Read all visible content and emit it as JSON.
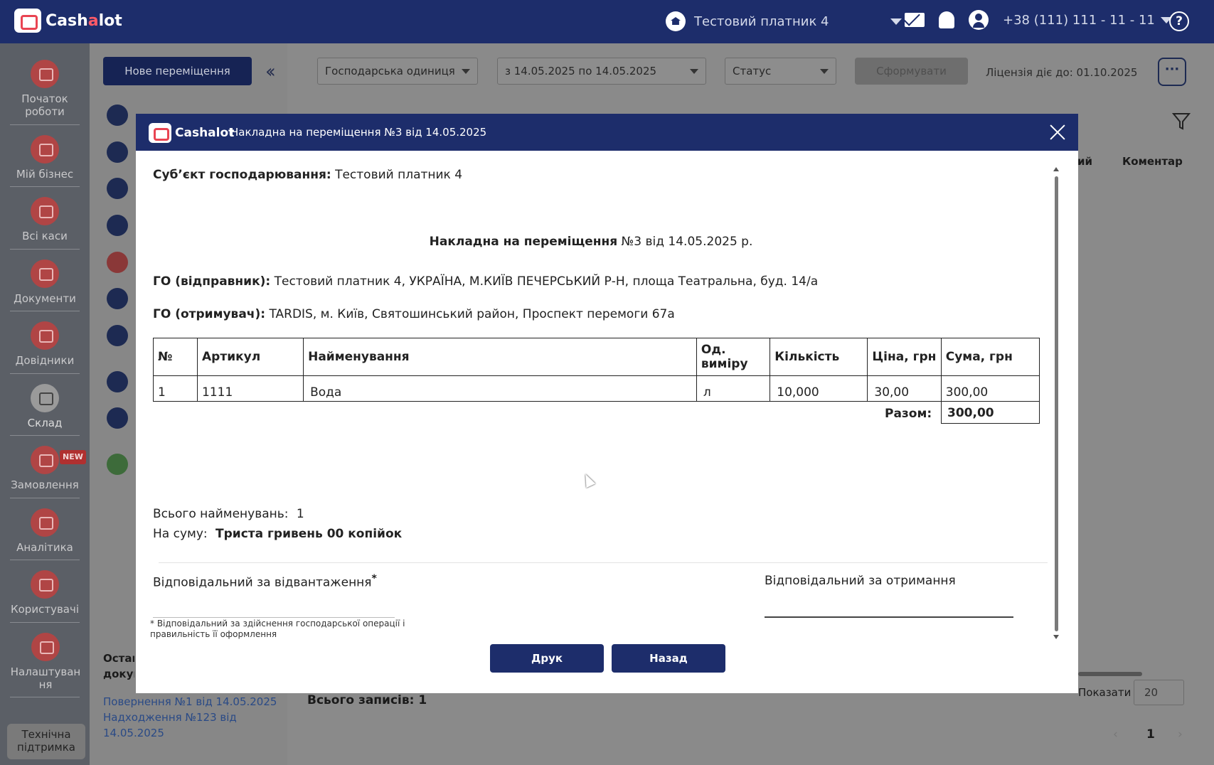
{
  "topbar": {
    "logo_text_pre": "Cash",
    "logo_text_accent": "a",
    "logo_text_post": "lot",
    "org_name": "Тестовий платник 4",
    "phone": "+38 (111) 111 - 11 - 11",
    "help": "?"
  },
  "sidebar": {
    "items": [
      {
        "label": "Початок роботи",
        "icon": "rocket-icon"
      },
      {
        "label": "Мій бізнес",
        "icon": "home-icon"
      },
      {
        "label": "Всі каси",
        "icon": "cash-register-icon"
      },
      {
        "label": "Документи",
        "icon": "documents-icon"
      },
      {
        "label": "Довідники",
        "icon": "directory-icon"
      },
      {
        "label": "Склад",
        "icon": "warehouse-icon"
      },
      {
        "label": "Замовлення",
        "icon": "delivery-icon"
      },
      {
        "label": "Аналітика",
        "icon": "analytics-icon"
      },
      {
        "label": "Користувачі",
        "icon": "users-icon"
      },
      {
        "label": "Налаштування",
        "icon": "gear-icon"
      }
    ],
    "new_badge": "NEW",
    "support_button": "Технічна підтримка"
  },
  "subpanel": {
    "new_move_button": "Нове переміщення",
    "last_docs_title": "Останні документи",
    "last_links": [
      "Повернення №1 від 14.05.2025",
      "Надходження №123 від 14.05.2025"
    ]
  },
  "filters": {
    "unit_placeholder": "Господарська одиниця",
    "date_range": "з 14.05.2025 по 14.05.2025",
    "status_placeholder": "Статус",
    "form_button": "Сформувати",
    "license": "Ліцензія діє до: 01.10.2025",
    "more": "···"
  },
  "table_bg": {
    "col_partial": "ий",
    "col_comment": "Коментар",
    "total_records": "Всього записів: 1",
    "show_label": "Показати",
    "show_value": "20",
    "page": "1"
  },
  "modal": {
    "logo_text": "Cashalot",
    "title": "Накладна на переміщення №3 від 14.05.2025",
    "subject_label": "Суб’єкт господарювання:",
    "subject_value": "Тестовий платник 4",
    "doc_title_bold": "Накладна на переміщення",
    "doc_title_rest": "№3 від 14.05.2025 р.",
    "sender_label": "ГО (відправник):",
    "sender_value": "Тестовий платник 4, УКРАЇНА, М.КИЇВ ПЕЧЕРСЬКИЙ Р-Н, площа Театральна, буд. 14/а",
    "receiver_label": "ГО (отримувач):",
    "receiver_value": "TARDIS, м. Київ, Святошинський район, Проспект перемоги 67а",
    "table": {
      "headers": [
        "№",
        "Артикул",
        "Найменування",
        "Од. виміру",
        "Кількість",
        "Ціна, грн",
        "Сума, грн"
      ],
      "rows": [
        [
          "1",
          "1111",
          "Вода",
          "л",
          "10,000",
          "30,00",
          "300,00"
        ]
      ]
    },
    "total_label": "Разом:",
    "total_value": "300,00",
    "count_label": "Всього найменувань:",
    "count_value": "1",
    "sum_label": "На суму:",
    "sum_value": "Триста гривень 00 копійок",
    "resp_ship": "Відповідальний за відвантаження",
    "resp_ship_mark": "*",
    "resp_recv": "Відповідальний за отримання",
    "footnote": "* Відповідальний за здійснення господарської операції і правильність її оформлення",
    "print_button": "Друк",
    "back_button": "Назад"
  }
}
